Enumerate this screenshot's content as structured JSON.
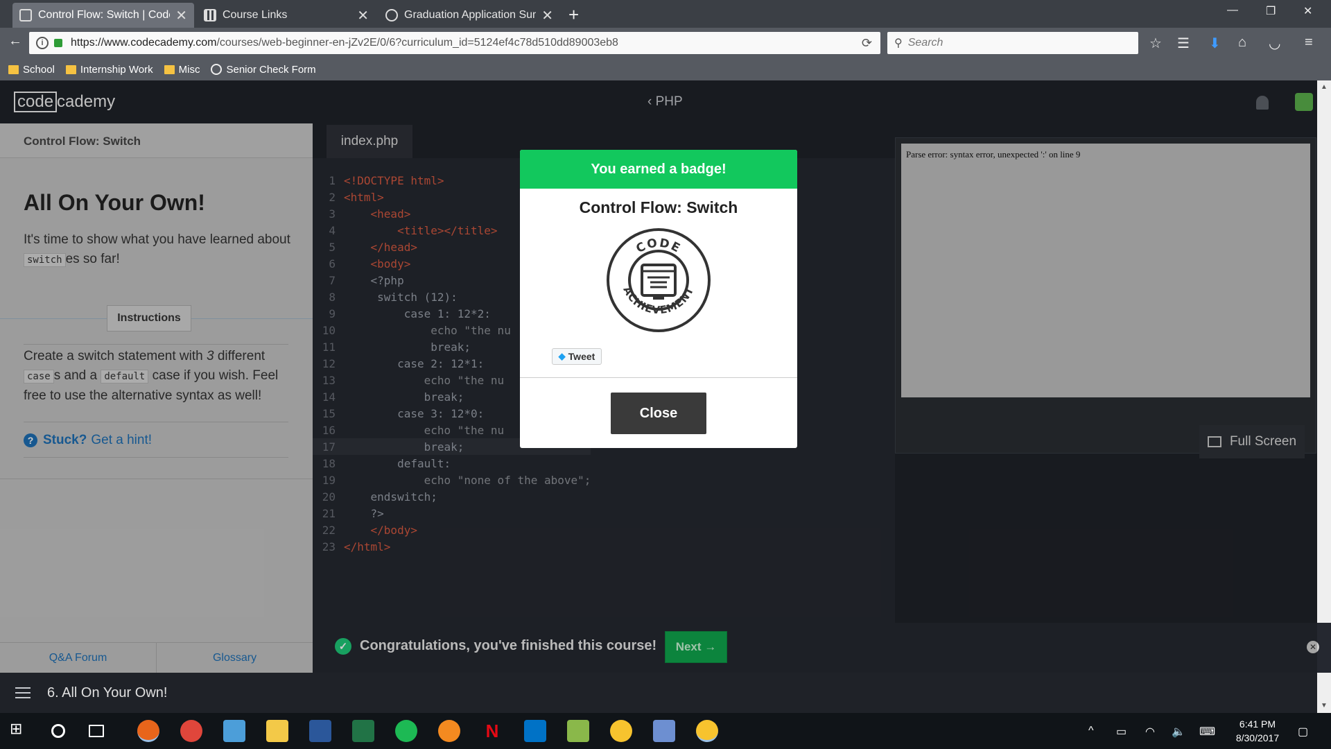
{
  "browser": {
    "tabs": [
      {
        "label": "Control Flow: Switch | Codec",
        "active": true
      },
      {
        "label": "Course Links",
        "active": false
      },
      {
        "label": "Graduation Application Sum",
        "active": false
      }
    ],
    "new_tab": "+",
    "url_domain": "https://www.codecademy.com",
    "url_path": "/courses/web-beginner-en-jZv2E/0/6?curriculum_id=5124ef4c78d510dd89003eb8",
    "search_placeholder": "Search",
    "bookmarks": [
      {
        "label": "School",
        "icon": "folder-icon"
      },
      {
        "label": "Internship Work",
        "icon": "folder-icon"
      },
      {
        "label": "Misc",
        "icon": "folder-icon"
      },
      {
        "label": "Senior Check Form",
        "icon": "globe-icon"
      }
    ]
  },
  "app": {
    "logo_boxed": "code",
    "logo_rest": "cademy",
    "course": "PHP"
  },
  "lesson": {
    "crumb": "Control Flow: Switch",
    "title": "All On Your Own!",
    "intro_1": "It's time to show what you have learned about",
    "intro_code": "switch",
    "intro_2": "es so far!",
    "instructions_tab": "Instructions",
    "instr_1": "Create a switch statement with",
    "instr_num": "3",
    "instr_2": "different",
    "instr_code_1": "case",
    "instr_3": "s and a",
    "instr_code_2": "default",
    "instr_4": "case if you wish. Feel free to use the alternative syntax as well!",
    "hint_bold": "Stuck?",
    "hint_text": "Get a hint!",
    "footer_left": "Q&A Forum",
    "footer_right": "Glossary"
  },
  "editor": {
    "file_tab": "index.php",
    "lines": [
      {
        "n": "1",
        "text": "<!DOCTYPE html>"
      },
      {
        "n": "2",
        "text": "<html>"
      },
      {
        "n": "3",
        "text": "    <head>"
      },
      {
        "n": "4",
        "text": "        <title></title>"
      },
      {
        "n": "5",
        "text": "    </head>"
      },
      {
        "n": "6",
        "text": "    <body>"
      },
      {
        "n": "7",
        "text": "    <?php"
      },
      {
        "n": "8",
        "text": "     switch (12):"
      },
      {
        "n": "9",
        "text": "         case 1: 12*2:"
      },
      {
        "n": "10",
        "text": "             echo \"the nu"
      },
      {
        "n": "11",
        "text": "             break;"
      },
      {
        "n": "12",
        "text": "        case 2: 12*1:"
      },
      {
        "n": "13",
        "text": "            echo \"the nu"
      },
      {
        "n": "14",
        "text": "            break;"
      },
      {
        "n": "15",
        "text": "        case 3: 12*0:"
      },
      {
        "n": "16",
        "text": "            echo \"the nu"
      },
      {
        "n": "17",
        "text": "            break;"
      },
      {
        "n": "18",
        "text": "        default:"
      },
      {
        "n": "19",
        "text": "            echo \"none of the above\";"
      },
      {
        "n": "20",
        "text": "    endswitch;"
      },
      {
        "n": "21",
        "text": "    ?>"
      },
      {
        "n": "22",
        "text": "    </body>"
      },
      {
        "n": "23",
        "text": "</html>"
      }
    ],
    "current_line": "17"
  },
  "output": {
    "text": "Parse error: syntax error, unexpected ':' on line 9",
    "fullscreen": "Full Screen"
  },
  "congrats": {
    "message": "Congratulations, you've finished this course!",
    "next": "Next →"
  },
  "bottom": {
    "title": "6. All On Your Own!"
  },
  "modal": {
    "header": "You earned a badge!",
    "title": "Control Flow: Switch",
    "badge_top": "CODE",
    "badge_bottom": "ACHIEVEMENT",
    "tweet": "Tweet",
    "close": "Close"
  },
  "taskbar": {
    "time": "6:41 PM",
    "date": "8/30/2017"
  }
}
